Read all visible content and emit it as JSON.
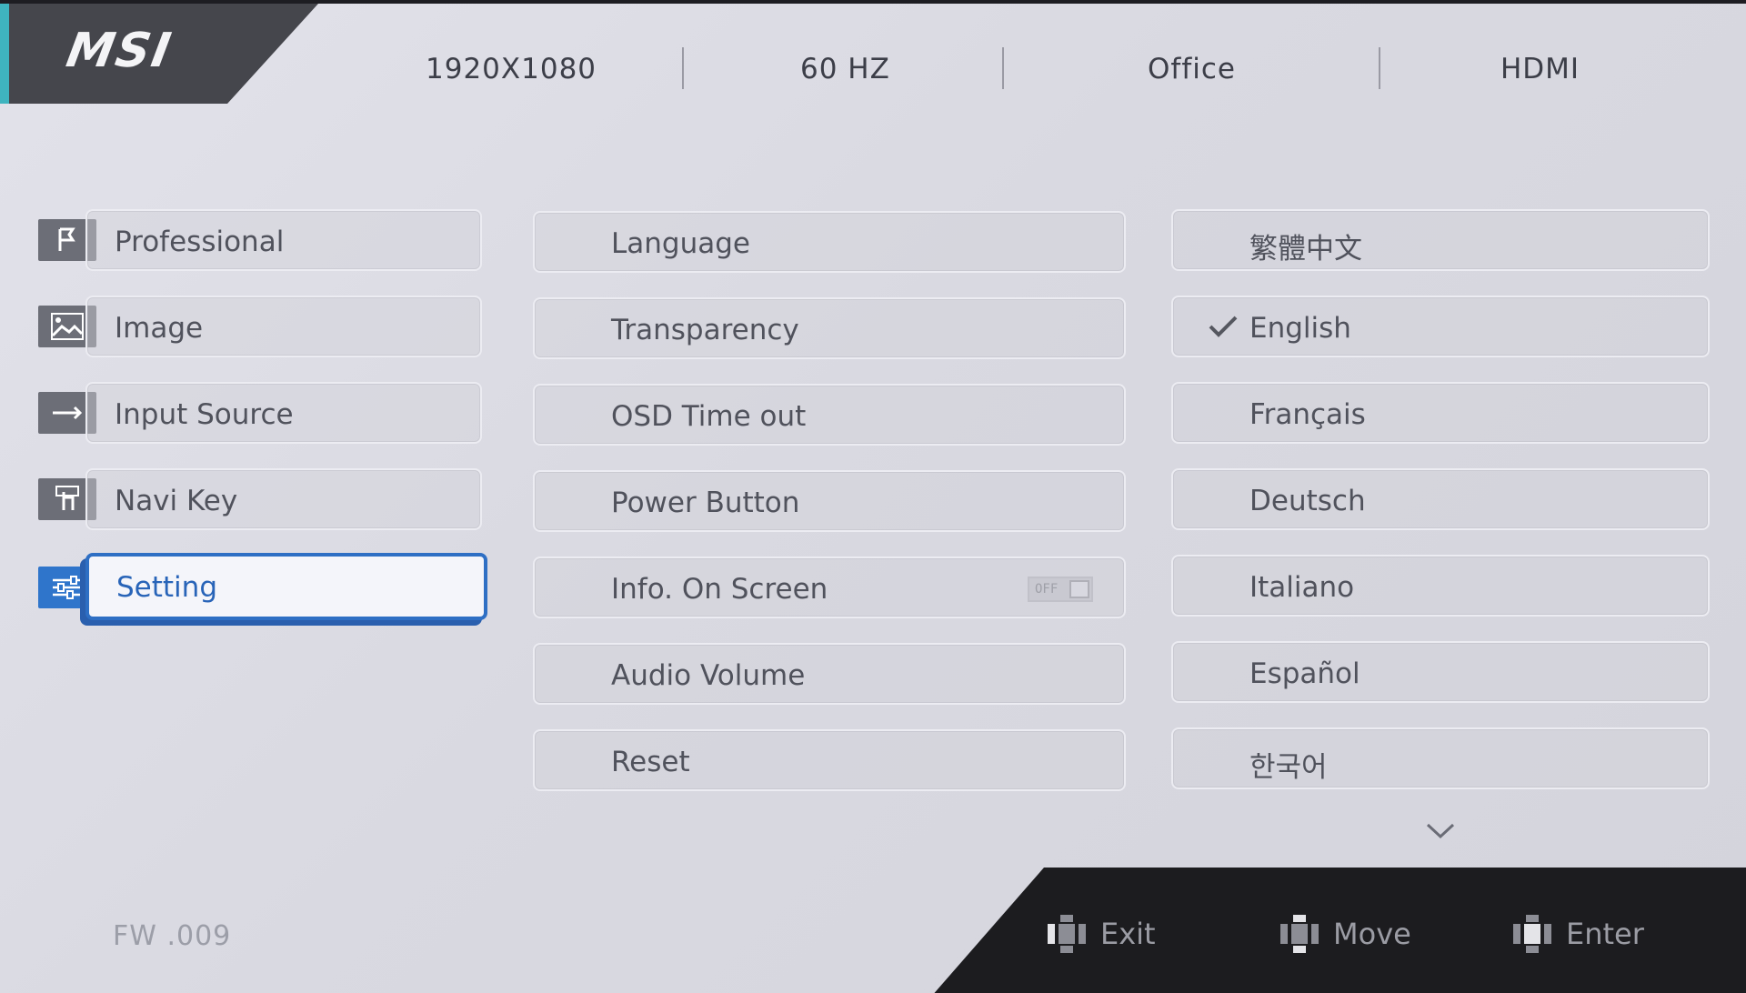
{
  "brand": {
    "logo_text": "MSI"
  },
  "header": {
    "resolution": "1920X1080",
    "refresh_rate": "60  HZ",
    "mode": "Office",
    "input": "HDMI"
  },
  "main_menu": {
    "items": [
      {
        "label": "Professional",
        "icon": "flag-icon",
        "selected": false
      },
      {
        "label": "Image",
        "icon": "image-icon",
        "selected": false
      },
      {
        "label": "Input Source",
        "icon": "arrow-right-icon",
        "selected": false
      },
      {
        "label": "Navi Key",
        "icon": "hand-icon",
        "selected": false
      },
      {
        "label": "Setting",
        "icon": "sliders-icon",
        "selected": true
      }
    ]
  },
  "settings_menu": {
    "items": [
      {
        "label": "Language"
      },
      {
        "label": "Transparency"
      },
      {
        "label": "OSD Time out"
      },
      {
        "label": "Power Button"
      },
      {
        "label": "Info. On Screen",
        "toggle": "OFF"
      },
      {
        "label": "Audio Volume"
      },
      {
        "label": "Reset"
      }
    ]
  },
  "language_menu": {
    "selected": "English",
    "items": [
      {
        "label": "繁體中文"
      },
      {
        "label": "English"
      },
      {
        "label": "Français"
      },
      {
        "label": "Deutsch"
      },
      {
        "label": "Italiano"
      },
      {
        "label": "Español"
      },
      {
        "label": "한국어"
      }
    ]
  },
  "firmware": "FW .009",
  "footer": {
    "exit_label": "Exit",
    "move_label": "Move",
    "enter_label": "Enter"
  },
  "colors": {
    "accent": "#2e6fc4",
    "panel": "#dcdce4",
    "footer": "#1c1c1f"
  }
}
